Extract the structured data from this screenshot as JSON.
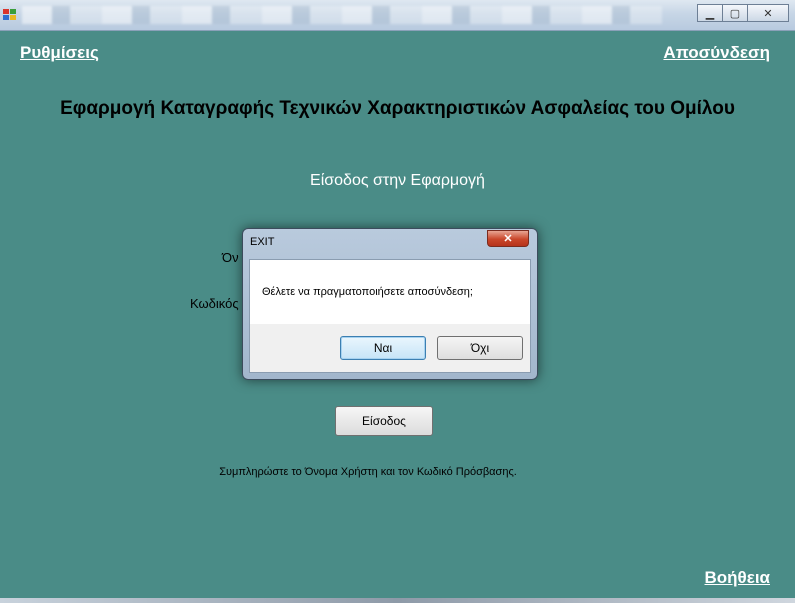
{
  "window": {
    "minimize_glyph": "▁",
    "maximize_glyph": "▢",
    "close_glyph": "✕"
  },
  "links": {
    "settings": "Ρυθμίσεις",
    "logout": "Αποσύνδεση",
    "help": "Βοήθεια"
  },
  "main": {
    "title": "Εφαρμογή Καταγραφής Τεχνικών Χαρακτηριστικών Ασφαλείας του Ομίλου",
    "subtitle": "Είσοδος στην Εφαρμογή",
    "username_label_partial": "Όν",
    "password_label_partial": "Κωδικός",
    "login_button": "Είσοδος",
    "hint": "Συμπληρώστε το Όνομα Χρήστη και τον Κωδικό Πρόσβασης."
  },
  "dialog": {
    "title": "EXIT",
    "close_glyph": "✕",
    "message": "Θέλετε να πραγματοποιήσετε αποσύνδεση;",
    "yes_button": "Ναι",
    "no_button": "Όχι"
  },
  "colors": {
    "background": "#4a8c87",
    "link_text": "#ffffff"
  }
}
